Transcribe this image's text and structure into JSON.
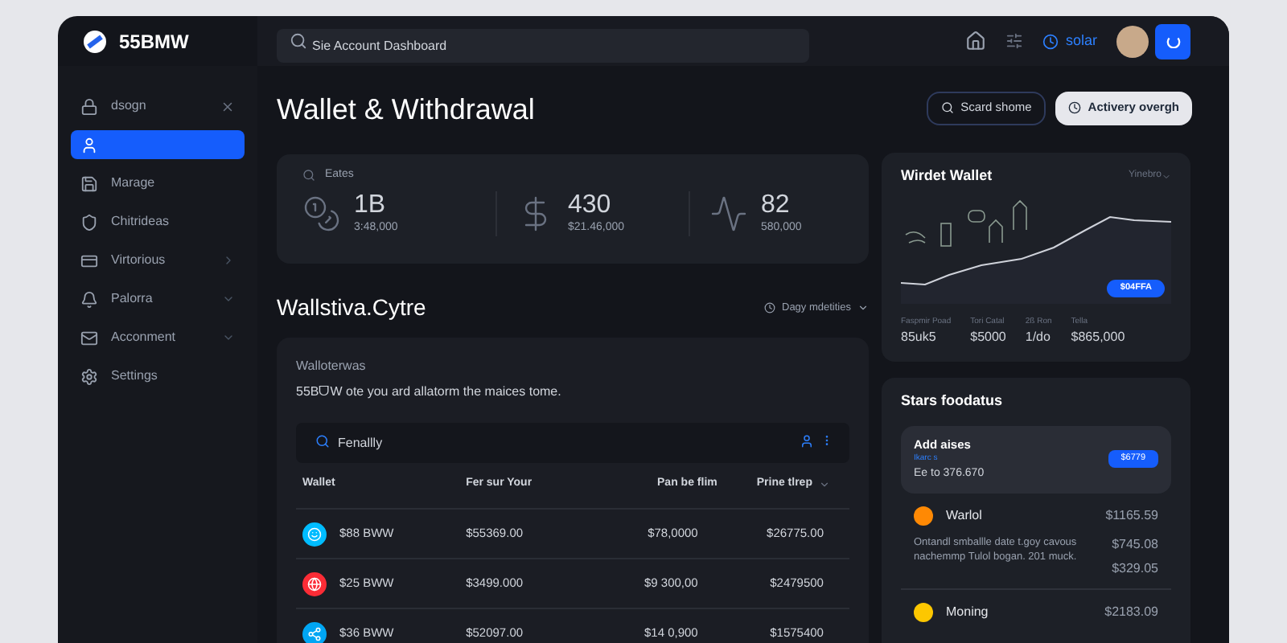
{
  "brand": {
    "name": "55BMW"
  },
  "search": {
    "placeholder": "Sie Account Dashboard"
  },
  "header": {
    "link": "solar"
  },
  "sidebar": {
    "items": [
      {
        "label": "dsogn",
        "selected": false
      },
      {
        "selected": true
      },
      {
        "label": "Marage",
        "selected": false
      },
      {
        "label": "Chitrideas",
        "selected": false
      },
      {
        "label": "Virtorious",
        "selected": false
      },
      {
        "label": "Palorra",
        "selected": false
      },
      {
        "label": "Acconment",
        "selected": false
      },
      {
        "label": "Settings",
        "selected": false
      }
    ]
  },
  "page": {
    "title": "Wallet & Withdrawal",
    "buttons": [
      {
        "label": "Scard shome",
        "kind": "outline"
      },
      {
        "label": "Activery overgh",
        "kind": "solid"
      }
    ]
  },
  "stats": {
    "label": "Eates",
    "items": [
      {
        "value": "1B",
        "sub": "3:48,000"
      },
      {
        "value": "430",
        "sub": "$21.46,000"
      },
      {
        "value": "82",
        "sub": "580,000"
      }
    ]
  },
  "section": {
    "title": "Wallstiva.Cytre",
    "filter": "Dagy mdetities"
  },
  "wallets_card": {
    "title": "Walloterwas",
    "text": "55BᗜW ote you ard allatorm the maices tome.",
    "search": {
      "value": "Fenallly"
    },
    "columns": [
      "Wallet",
      "Fer sur Your",
      "Pan be flim",
      "Prine tlrep"
    ],
    "rows": [
      {
        "cells": [
          "$88 BWW",
          "$55369.00",
          "$78,0000",
          "$26775.00"
        ]
      },
      {
        "cells": [
          "$25 BWW",
          "$3499.000",
          "$9 300,00",
          "$2479500"
        ]
      },
      {
        "cells": [
          "$36 BWW",
          "$52097.00",
          "$14 0,900",
          "$1575400"
        ]
      }
    ]
  },
  "wallet_widget": {
    "title": "Wirdet Wallet",
    "dropdown": "Yinebro",
    "badge": "$04FFA",
    "stats": [
      {
        "label": "Faspmir Poad",
        "value": "85uk5"
      },
      {
        "label": "Tori Catal",
        "value": "$5000"
      },
      {
        "label": "2ß Ron",
        "value": "1/do"
      },
      {
        "label": "Tella",
        "value": "$865,000"
      }
    ]
  },
  "status": {
    "title": "Stars foodatus",
    "highlight": {
      "title": "Add aises",
      "tag": "Ikarc s",
      "text": "Ee to 376.670",
      "badge": "$6779"
    },
    "entries": [
      {
        "name": "Warlol",
        "amount": "$1165.59",
        "text": "Ontandl smballle date t.goy cavous nachemmp Tulol bogan. 201 muck.",
        "amounts": [
          "$745.08",
          "$329.05"
        ]
      },
      {
        "name": "Moning",
        "amount": "$2183.09"
      }
    ]
  }
}
